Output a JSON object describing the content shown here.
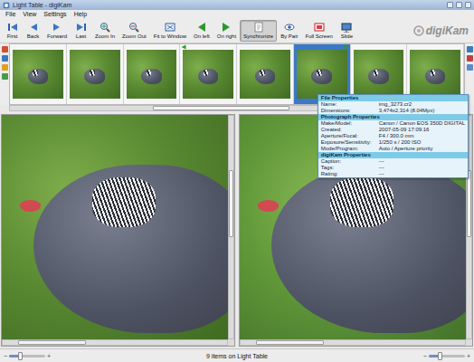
{
  "window": {
    "title": "Light Table - digiKam"
  },
  "menu": [
    "File",
    "View",
    "Settings",
    "Help"
  ],
  "toolbar": [
    {
      "label": "First",
      "selected": false
    },
    {
      "label": "Back",
      "selected": false
    },
    {
      "label": "Forward",
      "selected": false
    },
    {
      "label": "Last",
      "selected": false
    },
    {
      "label": "Zoom In",
      "selected": false
    },
    {
      "label": "Zoom Out",
      "selected": false
    },
    {
      "label": "Fit to Window",
      "selected": false
    },
    {
      "label": "On left",
      "selected": false
    },
    {
      "label": "On right",
      "selected": false
    },
    {
      "label": "Synchronize",
      "selected": true
    },
    {
      "label": "By Pair",
      "selected": false
    },
    {
      "label": "Full Screen",
      "selected": false
    },
    {
      "label": "Slide",
      "selected": false
    }
  ],
  "logo": "digiKam",
  "thumbnails": [
    {
      "selected": false,
      "on_left": false,
      "on_right": false
    },
    {
      "selected": false,
      "on_left": false,
      "on_right": false
    },
    {
      "selected": false,
      "on_left": false,
      "on_right": false
    },
    {
      "selected": false,
      "on_left": true,
      "on_right": false
    },
    {
      "selected": false,
      "on_left": false,
      "on_right": false
    },
    {
      "selected": true,
      "on_left": false,
      "on_right": true
    },
    {
      "selected": false,
      "on_left": false,
      "on_right": false
    },
    {
      "selected": false,
      "on_left": false,
      "on_right": false
    }
  ],
  "thumbnail_scroll": {
    "level": 0.45
  },
  "tooltip": {
    "sections": [
      {
        "title": "File Properties",
        "rows": [
          {
            "label": "Name:",
            "value": "img_3273.cr2"
          },
          {
            "label": "Dimensions:",
            "value": "3,474x2,314 (8.04Mpx)"
          }
        ]
      },
      {
        "title": "Photograph Properties",
        "rows": [
          {
            "label": "Make/Model:",
            "value": "Canon / Canon EOS 350D DIGITAL"
          },
          {
            "label": "Created:",
            "value": "2007-05-09 17:09:16"
          },
          {
            "label": "Aperture/Focal:",
            "value": "F4 / 300.0 mm"
          },
          {
            "label": "Exposure/Sensitivity:",
            "value": "1/250 s / 200 ISO"
          },
          {
            "label": "Mode/Program:",
            "value": "Auto / Aperture priority"
          }
        ]
      },
      {
        "title": "digiKam Properties",
        "rows": [
          {
            "label": "Caption:",
            "value": "---"
          },
          {
            "label": "Tags:",
            "value": "---"
          },
          {
            "label": "Rating:",
            "value": "---"
          }
        ]
      }
    ]
  },
  "panes": [
    {
      "h_scroll": {
        "level": 0.1
      },
      "v_scroll": {
        "level": 0.35
      }
    },
    {
      "h_scroll": {
        "level": 0.1
      },
      "v_scroll": {
        "level": 0.35
      }
    }
  ],
  "status_bar": {
    "text": "9 items on Light Table",
    "left_zoom": {
      "level": 0.3
    },
    "right_zoom": {
      "level": 0.3
    }
  }
}
